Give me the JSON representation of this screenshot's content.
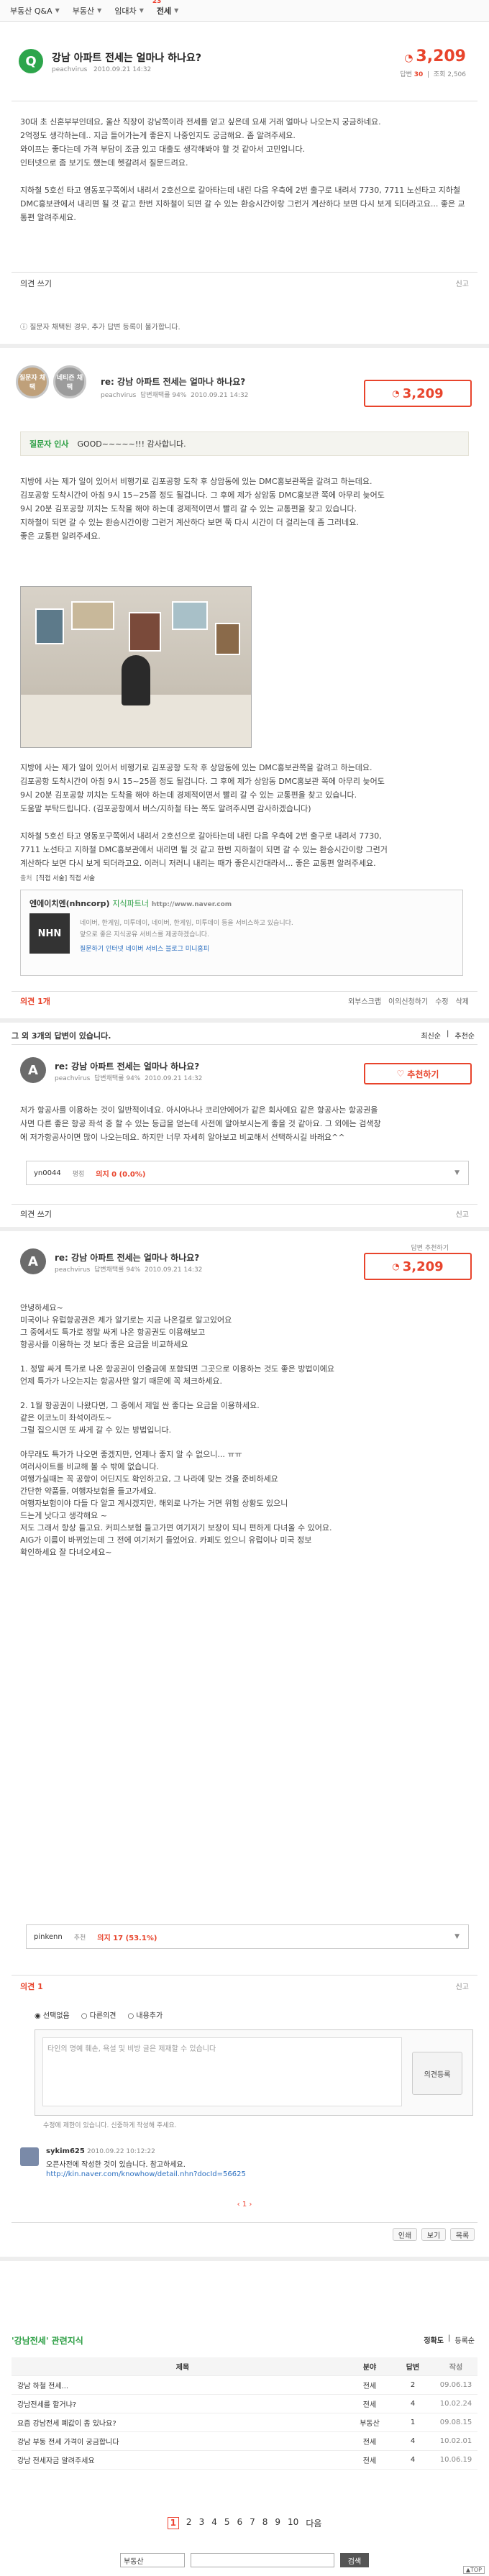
{
  "nav": {
    "items": [
      {
        "label": "부동산 Q&A"
      },
      {
        "label": "부동산"
      },
      {
        "label": "임대차"
      },
      {
        "label": "전세"
      }
    ],
    "badge": "23"
  },
  "question": {
    "icon": "Q",
    "title": "강남 아파트 전세는 얼마나 하나요?",
    "author": "peachvirus",
    "date": "2010.09.21 14:32",
    "points": "3,209",
    "answer_count_label": "답변",
    "answer_count": "30",
    "view_label": "조회",
    "view_count": "2,506",
    "body": [
      "30대 초 신혼부부인데요, 울산 직장이 강남쪽이라 전세를 얻고 싶은데 요새 거래 얼마나 나오는지 궁금하네요.",
      "2억정도 생각하는데.. 지금 들어가는게 좋은지 나중인지도 궁금해요. 좀 알려주세요.",
      "와이프는 좋다는데 가격 부담이 조금 있고 대출도 생각해봐야 할 것 같아서 고민입니다.",
      "인터넷으로 좀 보기도 했는데 헷갈려서 질문드려요.",
      "",
      "지하철 5호선 타고 영동포구쪽에서 내려서 2호선으로 갈아타는데 내린 다음 우측에 2번 출구로 내려서 7730, 7711 노선타고 지하철 DMC홍보관에서 내리면 될 것 같고 한번 지하철이 되면 갈 수 있는 환승시간이랑 그런거 계산하다 보면 다시 보게 되더라고요... 좋은 교통편 알려주세요."
    ],
    "comment_link": "의견 쓰기",
    "report": "신고",
    "notice": "질문자 채택된 경우, 추가 답변 등록이 불가합니다."
  },
  "answer1": {
    "medal1": "질문자 채택",
    "medal2": "네티즌 채택",
    "title": "re: 강남 아파트 전세는 얼마나 하나요?",
    "author": "peachvirus",
    "rank": "답변채택률 94%",
    "date": "2010.09.21 14:32",
    "points": "3,209",
    "thanks_label": "질문자 인사",
    "thanks_text": "GOOD~~~~~!!! 감사합니다.",
    "body1": [
      "지방에 사는 제가 일이 있어서 비행기로 김포공항 도착 후 상암동에 있는 DMC홍보관쪽을 갈려고 하는데요.",
      "김포공항 도착시간이 아침 9시 15~25쯤 정도 될겁니다. 그 후에 제가 상암동 DMC홍보관 쪽에 아무리 늦어도",
      "9시 20분 김포공항 끼치는 도착을 해야 하는데 경제적이면서 빨리 갈 수 있는 교통편을 찾고 있습니다.",
      "지하철이 되면 갈 수 있는 환승시간이랑 그런거 계산하다 보면 쭉 다시 시간이 더 걸리는데 좀 그러네요.",
      "좋은 교통편 알려주세요."
    ],
    "body2": [
      "지방에 사는 제가 일이 있어서 비행기로 김포공항 도착 후 상암동에 있는 DMC홍보관쪽을 갈려고 하는데요.",
      "김포공항 도착시간이 아침 9시 15~25쯤 정도 될겁니다. 그 후에 제가 상암동 DMC홍보관 쪽에 아무리 늦어도",
      "9시 20분 김포공항 끼치는 도착을 해야 하는데 경제적이면서 빨리 갈 수 있는 교통편을 찾고 있습니다.",
      "도움말 부탁드립니다. (김포공항에서 버스/지하철 타는 쪽도 알려주시면 감사하겠습니다)",
      "",
      "지하철 5호선 타고 영동포구쪽에서 내려서 2호선으로 갈아타는데 내린 다음 우측에 2번 출구로 내려서 7730,",
      "7711 노선타고 지하철 DMC홍보관에서 내리면 될 것 같고 한번 지하철이 되면 갈 수 있는 환승시간이랑 그런거",
      "계산하다 보면 다시 보게 되더라고요. 이러니 저러니 내리는 때가 좋은시간대라서... 좋은 교통편 알려주세요."
    ],
    "source_label": "출처",
    "source_text": "[직접 서술] 직접 서술",
    "profile_name": "엔에이치엔(nhncorp)",
    "profile_tag": "지식파트너",
    "profile_url": "http://www.naver.com",
    "profile_desc1": "네이버, 한게임, 미투데이, 네이버, 한게임, 미투데이 등을 서비스하고 있습니다.",
    "profile_desc2": "앞으로 좋은 지식공유 서비스를 제공하겠습니다.",
    "profile_links": "질문하기  인터넷  네이버 서비스  블로그  미니홈피",
    "profile_logo": "NHN",
    "comment_link": "의견 1개",
    "actions": [
      "의견쓰기",
      "외부스크랩",
      "이의신청하기",
      "수정",
      "삭제"
    ]
  },
  "answers_header": {
    "count_text": "그 외 3개의 답변이 있습니다.",
    "sort": "최신순",
    "sort2": "추천순"
  },
  "answer2": {
    "avatar": "A",
    "title": "re: 강남 아파트 전세는 얼마나 하나요?",
    "author": "peachvirus",
    "rank": "답변채택률 94%",
    "date": "2010.09.21 14:32",
    "recommend": "추천하기",
    "body": [
      "저가 항공사를 이용하는 것이 일반적이네요. 아시아나나 코리안에어가 같은 회사예요 같은 항공사는 항공권을",
      "사면 다른 좋은 항공 좌석 중 할 수 있는 등급을 얻는데 사전에 알아보시는게 좋을 것 같아요. 그 외에는 검색창",
      "에 저가항공사이면 많이 나오는데요. 하지만 너무 자세히 알아보고 비교해서 선택하시길 바래요^^"
    ],
    "voter": "yn0044",
    "vote_label": "평점",
    "vote_pct": "의지 0 (0.0%)",
    "comment_link": "의견 쓰기",
    "report": "신고"
  },
  "answer3": {
    "avatar": "A",
    "title": "re: 강남 아파트 전세는 얼마나 하나요?",
    "author": "peachvirus",
    "rank": "답변채택률 94%",
    "date": "2010.09.21 14:32",
    "points": "3,209",
    "points_caption": "답변 추천하기",
    "body": [
      "안녕하세요~",
      "미국이나 유럽항공권은 제가 알기로는 지금 나온걸로 알고있어요",
      "그 중에서도 특가로 정말 싸게 나온 항공권도 이용해보고",
      "항공사를 이용하는 것 보다 좋은 요금을 비교하세요",
      "",
      "1. 정말 싸게 특가로 나온 항공권이 인출금에 포함되면 그곳으로 이용하는 것도 좋은 방법이에요",
      "   언제 특가가 나오는지는 항공사만 알기 때문에 꼭 체크하세요.",
      "",
      "2. 1월 항공권이 나왔다면, 그 중에서 제일 싼 좋다는 요금을 이용하세요.",
      "같은 이코노미 좌석이라도~",
      "그럴 집으시면 또 싸게 갈 수 있는 방법입니다.",
      "",
      "아무래도 특가가 나오면 좋겠지만, 언제나 좋지 알 수 없으니... ㅠㅠ",
      "여러사이트를 비교해 볼 수 밖에 없습니다.",
      "여행가실때는 꼭 공항이 어딘지도 확인하고요, 그 나라에 맞는 것을 준비하세요",
      "간단한 약품들, 여행자보험을 들고가세요.",
      "여행자보험이야 다들 다 알고 계시겠지만, 해외로 나가는 거면 위험 상황도 있으니",
      "드는게 낫다고 생각해요 ~",
      "저도 그래서 항상 들고요. 커피스보험 들고가면 여기저기 보장이 되니 편하게 다녀올 수 있어요.",
      "AIG가 이름이 바뀌었는데 그 전에 여기저기 들었어요. 카페도 있으니 유럽이나 미국 정보",
      "확인하세요 잘 다녀오세요~"
    ],
    "voter": "pinkenn",
    "vote_label": "추천",
    "vote_pct": "의지 17 (53.1%)",
    "comment_link": "의견 1",
    "report": "신고"
  },
  "comment_form": {
    "opt1": "선택없음",
    "opt2": "다른의견",
    "opt3": "내용추가",
    "placeholder1": "타인의 명예 훼손, 욕설 및 비방 글은 제재할 수 있습니다",
    "placeholder2": "수정에 제한이 있습니다. 신중하게 작성해 주세요.",
    "submit": "의견등록",
    "counter": "0 / 300"
  },
  "comment": {
    "author": "sykim625",
    "date": "2010.09.22 10:12:22",
    "text": "오픈사전에 작성한 것이 있습니다. 참고하세요.",
    "link": "http://kin.naver.com/knowhow/detail.nhn?docId=56625"
  },
  "page_actions": [
    "인쇄",
    "보기",
    "목록"
  ],
  "related": {
    "title": "'강남전세' 관련지식",
    "sort": "정확도",
    "sort2": "등록순",
    "headers": {
      "title": "제목",
      "cat": "분야",
      "ans": "답변",
      "date": "작성"
    },
    "rows": [
      {
        "title": "강남 하철 전세...",
        "cat": "전세",
        "ans": "2",
        "date": "09.06.13"
      },
      {
        "title": "강남전세를 할거냐?",
        "cat": "전세",
        "ans": "4",
        "date": "10.02.24"
      },
      {
        "title": "요즘 강남전세 폐값이 좀 있나요?",
        "cat": "부동산",
        "ans": "1",
        "date": "09.08.15"
      },
      {
        "title": "강남 부동 전세 가격이 궁금합니다",
        "cat": "전세",
        "ans": "4",
        "date": "10.02.01"
      },
      {
        "title": "강남 전세자금 알려주세요",
        "cat": "전세",
        "ans": "4",
        "date": "10.06.19"
      }
    ]
  },
  "pager": [
    "1",
    "2",
    "3",
    "4",
    "5",
    "6",
    "7",
    "8",
    "9",
    "10",
    "다음"
  ],
  "footer": {
    "select": "부동산",
    "search": "검색",
    "top": "TOP"
  }
}
